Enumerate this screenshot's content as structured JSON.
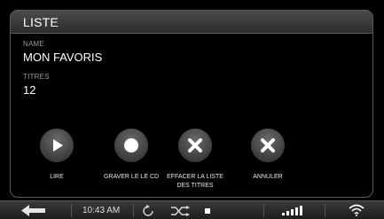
{
  "panel": {
    "title": "LISTE"
  },
  "fields": {
    "name_label": "NAME",
    "name_value": "MON FAVORIS",
    "titles_label": "TITRES",
    "titles_value": "12"
  },
  "actions": [
    {
      "label": "LIRE",
      "icon": "play-icon"
    },
    {
      "label": "GRAVER LE LE CD",
      "icon": "record-icon"
    },
    {
      "label": "EFFACER LA LISTE DES TITRES",
      "icon": "close-icon"
    },
    {
      "label": "ANNULER",
      "icon": "close-icon"
    }
  ],
  "statusbar": {
    "time": "10:43 AM",
    "back_icon": "back-arrow-icon",
    "repeat_icon": "repeat-icon",
    "shuffle_icon": "shuffle-icon",
    "stop_icon": "stop-icon",
    "signal_icon": "signal-strength-icon",
    "wifi_icon": "wifi-icon"
  }
}
